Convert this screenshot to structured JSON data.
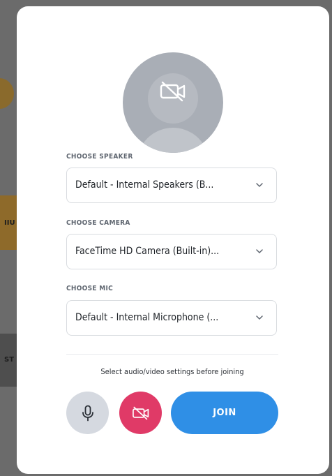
{
  "background": {
    "fragment_1": "IIU",
    "fragment_2": "ST"
  },
  "preview": {
    "icon": "camera-off-icon"
  },
  "speaker": {
    "label": "CHOOSE SPEAKER",
    "value": "Default - Internal Speakers (B..."
  },
  "camera": {
    "label": "CHOOSE CAMERA",
    "value": "FaceTime HD Camera (Built-in)..."
  },
  "mic": {
    "label": "CHOOSE MIC",
    "value": "Default - Internal Microphone (..."
  },
  "hint": "Select audio/video settings before joining",
  "controls": {
    "mic_icon": "microphone-icon",
    "camera_icon": "camera-off-icon",
    "join_label": "JOIN"
  },
  "colors": {
    "join": "#2f8fe6",
    "camera_off": "#e03a67",
    "mic_button": "#d5d9e0"
  }
}
